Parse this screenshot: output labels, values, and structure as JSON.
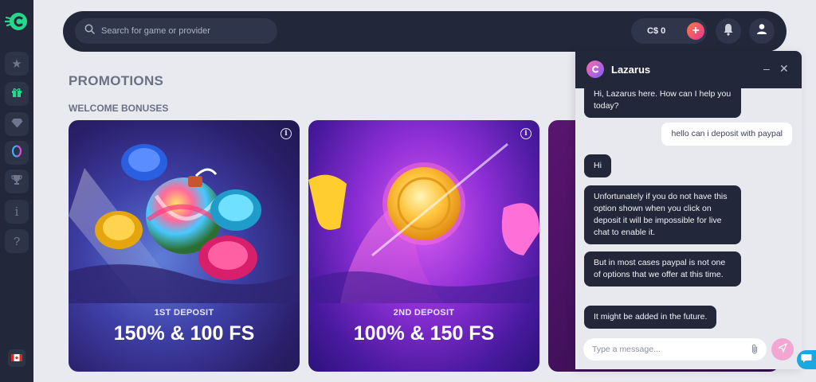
{
  "header": {
    "search_placeholder": "Search for game or provider",
    "balance": "C$ 0"
  },
  "sidebar": {
    "items": [
      {
        "icon": "star-icon"
      },
      {
        "icon": "gift-icon"
      },
      {
        "icon": "diamond-icon"
      },
      {
        "icon": "loyalty-ring-icon"
      },
      {
        "icon": "trophy-icon"
      },
      {
        "icon": "info-icon"
      },
      {
        "icon": "help-icon"
      }
    ],
    "flag": "canada-flag-icon"
  },
  "page": {
    "title": "PROMOTIONS",
    "section": "WELCOME BONUSES"
  },
  "cards": [
    {
      "subtitle": "1ST DEPOSIT",
      "offer": "150% & 100 FS"
    },
    {
      "subtitle": "2ND DEPOSIT",
      "offer": "100% & 150 FS"
    },
    {
      "subtitle": "",
      "offer": ""
    }
  ],
  "chat": {
    "agent_name": "Lazarus",
    "messages": [
      {
        "from": "agent",
        "text": "Hi, Lazarus here. How can I help you today?"
      },
      {
        "from": "user",
        "text": "hello can i deposit with paypal"
      },
      {
        "from": "agent",
        "text": "Hi"
      },
      {
        "from": "agent",
        "text": "Unfortunately if you do not have this option shown when you click on deposit it will be impossible for live chat to enable it."
      },
      {
        "from": "agent",
        "text": "But in most cases paypal is not one of options that we offer at this time."
      },
      {
        "from": "agent",
        "text": "It might be added in the future."
      }
    ],
    "composer_placeholder": "Type a message..."
  },
  "colors": {
    "navy": "#22283a",
    "accent_pink": "#e3359a",
    "accent_orange": "#ff7a3d",
    "logo_green": "#27d88a"
  }
}
